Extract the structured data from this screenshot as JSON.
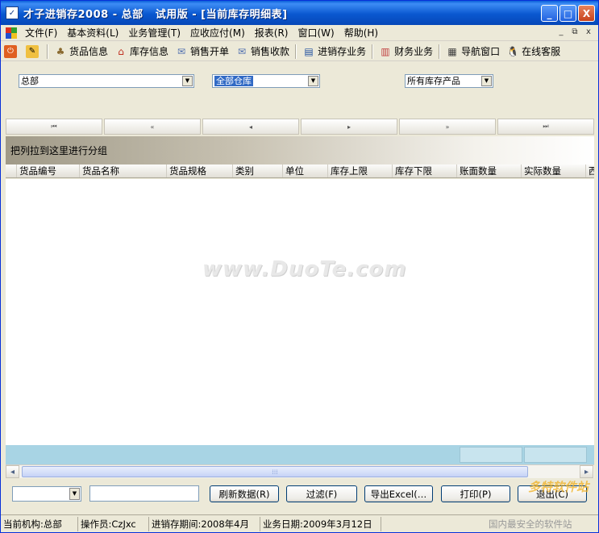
{
  "window": {
    "title": "才子进销存2008 - 总部   试用版 - [当前库存明细表]",
    "controls": {
      "minimize": "_",
      "maximize": "□",
      "close": "X"
    }
  },
  "menu": {
    "items": [
      "文件(F)",
      "基本资料(L)",
      "业务管理(T)",
      "应收应付(M)",
      "报表(R)",
      "窗口(W)",
      "帮助(H)"
    ],
    "mdi_controls": [
      "_",
      "⧉",
      "x"
    ]
  },
  "toolbar": {
    "items": [
      "货品信息",
      "库存信息",
      "销售开单",
      "销售收款",
      "进销存业务",
      "财务业务",
      "导航窗口",
      "在线客服"
    ]
  },
  "filters": {
    "org": "总部",
    "warehouse": "全部仓库",
    "product_scope": "所有库存产品"
  },
  "nav": {
    "first": "⏮",
    "prev_page": "«",
    "prev": "◂",
    "next": "▸",
    "next_page": "»",
    "last": "⏭"
  },
  "group_panel": {
    "hint": "把列拉到这里进行分组"
  },
  "grid": {
    "columns": [
      "货品编号",
      "货品名称",
      "货品规格",
      "类别",
      "单位",
      "库存上限",
      "库存下限",
      "账面数量",
      "实际数量",
      "西"
    ]
  },
  "watermark": "www.DuoTe.com",
  "bottom": {
    "refresh": "刷新数据(R)",
    "filter": "过滤(F)",
    "export": "导出Excel(…",
    "print": "打印(P)",
    "exit": "退出(C)"
  },
  "status": {
    "org": "当前机构:总部",
    "operator": "操作员:CzJxc",
    "period": "进销存期间:2008年4月",
    "biz_date": "业务日期:2009年3月12日"
  },
  "brand": {
    "logo_text": "多特软件站",
    "slogan": "国内最安全的软件站"
  },
  "colors": {
    "titlebar": "#0a58d0",
    "selection": "#316ac5",
    "footer_row": "#a8d4e4"
  }
}
